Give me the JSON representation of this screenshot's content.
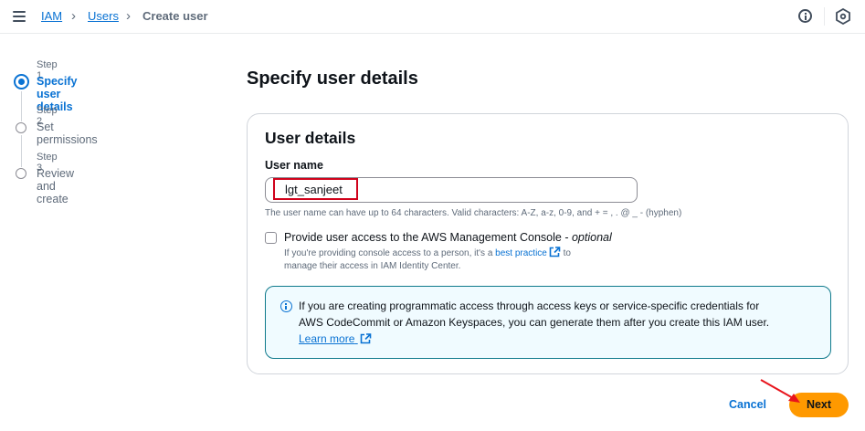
{
  "breadcrumb": {
    "items": [
      "IAM",
      "Users"
    ],
    "current": "Create user"
  },
  "steps": [
    {
      "label": "Step 1",
      "title": "Specify user details",
      "active": true
    },
    {
      "label": "Step 2",
      "title": "Set permissions",
      "active": false
    },
    {
      "label": "Step 3",
      "title": "Review and create",
      "active": false
    }
  ],
  "page": {
    "title": "Specify user details"
  },
  "panel": {
    "title": "User details",
    "username_label": "User name",
    "username_value": "lgt_sanjeet",
    "username_constraint": "The user name can have up to 64 characters. Valid characters: A-Z, a-z, 0-9, and + = , . @ _ - (hyphen)",
    "console_access_label": "Provide user access to the AWS Management Console - ",
    "console_access_optional": "optional",
    "console_desc_prefix": "If you're providing console access to a person, it's a ",
    "console_desc_link": "best practice",
    "console_desc_suffix": " to",
    "console_desc_line2": "manage their access in IAM Identity Center."
  },
  "info_box": {
    "line1": "If you are creating programmatic access through access keys or service-specific credentials for",
    "line2": "AWS CodeCommit or Amazon Keyspaces, you can generate them after you create this IAM user.",
    "link": "Learn more"
  },
  "actions": {
    "cancel": "Cancel",
    "next": "Next"
  },
  "colors": {
    "accent": "#0972d3",
    "primary_button": "#ff9900",
    "highlight_box": "#d0021b",
    "info_border": "#0f7a8c"
  },
  "icons": [
    "hamburger-menu-icon",
    "chevron-right-icon",
    "info-icon",
    "settings-hex-icon",
    "external-link-icon",
    "info-circle-icon"
  ]
}
